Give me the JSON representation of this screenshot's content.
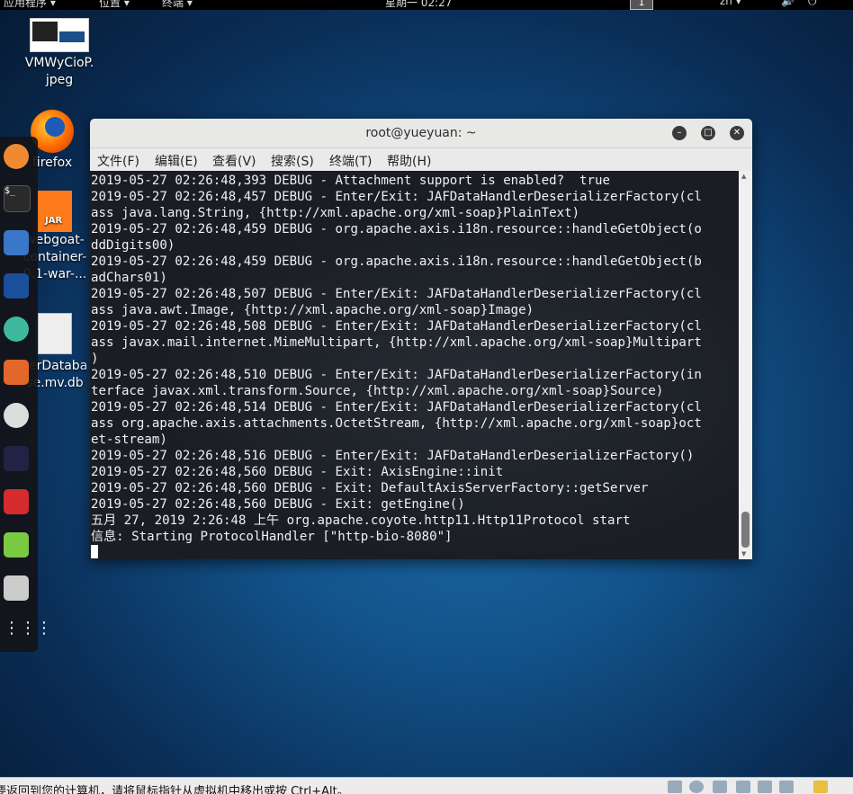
{
  "topbar": {
    "applications": "应用程序 ▾",
    "places": "位置 ▾",
    "terminal": "终端 ▾",
    "clock": "星期一 02:27",
    "workspace": "1",
    "lang": "zh ▾"
  },
  "desktop": {
    "icons": [
      {
        "label1": "VMWyCioP.",
        "label2": "jpeg"
      },
      {
        "label1": "firefox"
      },
      {
        "label1": "webgoat-",
        "label2": "container-",
        "label3": "0.1-war-..."
      },
      {
        "label1": "serDataba",
        "label2": "se.mv.db"
      }
    ]
  },
  "window": {
    "title": "root@yueyuan: ~",
    "menu": [
      "文件(F)",
      "编辑(E)",
      "查看(V)",
      "搜索(S)",
      "终端(T)",
      "帮助(H)"
    ],
    "terminal_text": "2019-05-27 02:26:48,393 DEBUG - Attachment support is enabled?  true\n2019-05-27 02:26:48,457 DEBUG - Enter/Exit: JAFDataHandlerDeserializerFactory(cl\nass java.lang.String, {http://xml.apache.org/xml-soap}PlainText)\n2019-05-27 02:26:48,459 DEBUG - org.apache.axis.i18n.resource::handleGetObject(o\nddDigits00)\n2019-05-27 02:26:48,459 DEBUG - org.apache.axis.i18n.resource::handleGetObject(b\nadChars01)\n2019-05-27 02:26:48,507 DEBUG - Enter/Exit: JAFDataHandlerDeserializerFactory(cl\nass java.awt.Image, {http://xml.apache.org/xml-soap}Image)\n2019-05-27 02:26:48,508 DEBUG - Enter/Exit: JAFDataHandlerDeserializerFactory(cl\nass javax.mail.internet.MimeMultipart, {http://xml.apache.org/xml-soap}Multipart\n)\n2019-05-27 02:26:48,510 DEBUG - Enter/Exit: JAFDataHandlerDeserializerFactory(in\nterface javax.xml.transform.Source, {http://xml.apache.org/xml-soap}Source)\n2019-05-27 02:26:48,514 DEBUG - Enter/Exit: JAFDataHandlerDeserializerFactory(cl\nass org.apache.axis.attachments.OctetStream, {http://xml.apache.org/xml-soap}oct\net-stream)\n2019-05-27 02:26:48,516 DEBUG - Enter/Exit: JAFDataHandlerDeserializerFactory()\n2019-05-27 02:26:48,560 DEBUG - Exit: AxisEngine::init\n2019-05-27 02:26:48,560 DEBUG - Exit: DefaultAxisServerFactory::getServer\n2019-05-27 02:26:48,560 DEBUG - Exit: getEngine()\n五月 27, 2019 2:26:48 上午 org.apache.coyote.http11.Http11Protocol start\n信息: Starting ProtocolHandler [\"http-bio-8080\"]\n"
  },
  "statusbar": {
    "message": "要返回到您的计算机，请将鼠标指针从虚拟机中移出或按 Ctrl+Alt。"
  },
  "colors": {
    "dock_bg": "#141418",
    "terminal_bg": "#1a1e24",
    "titlebar_bg": "#e8e8e7"
  }
}
